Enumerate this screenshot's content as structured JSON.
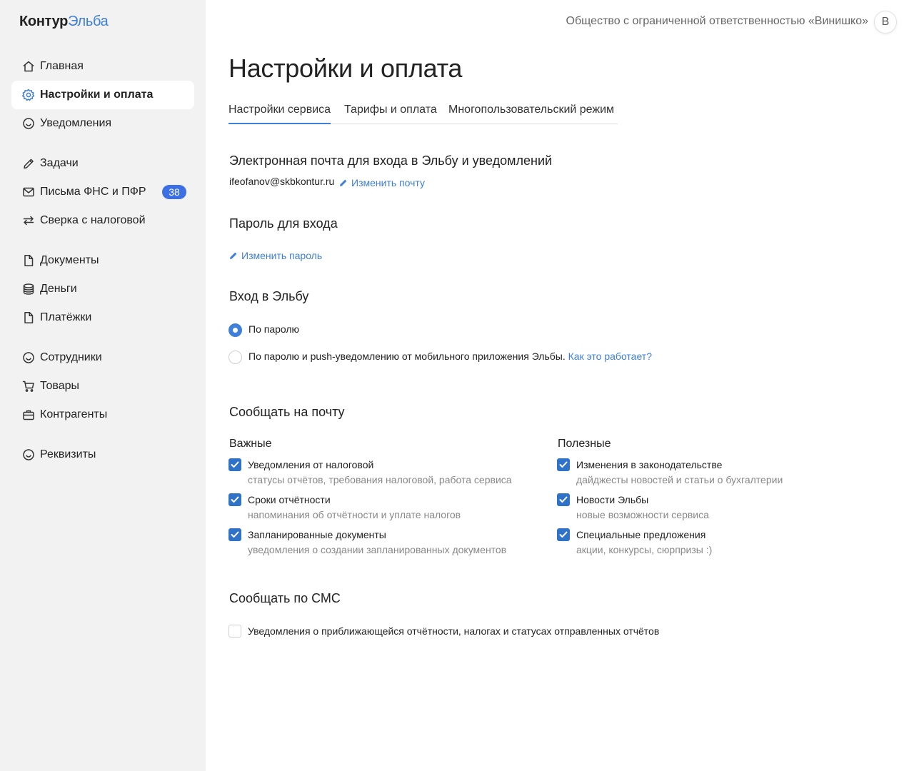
{
  "brand": {
    "name": "Контур",
    "product": "Эльба"
  },
  "sidebar": {
    "items": [
      {
        "label": "Главная",
        "icon": "home-icon"
      },
      {
        "label": "Настройки и оплата",
        "icon": "settings-gear-icon",
        "active": true
      },
      {
        "label": "Уведомления",
        "icon": "smiley-icon"
      },
      {
        "label": "Задачи",
        "icon": "pencil-icon"
      },
      {
        "label": "Письма ФНС и ПФР",
        "icon": "envelope-icon",
        "badge": "38"
      },
      {
        "label": "Сверка с налоговой",
        "icon": "swap-arrows-icon"
      },
      {
        "label": "Документы",
        "icon": "document-icon"
      },
      {
        "label": "Деньги",
        "icon": "coins-stack-icon"
      },
      {
        "label": "Платёжки",
        "icon": "document-icon"
      },
      {
        "label": "Сотрудники",
        "icon": "smiley-icon"
      },
      {
        "label": "Товары",
        "icon": "cart-icon"
      },
      {
        "label": "Контрагенты",
        "icon": "briefcase-icon"
      },
      {
        "label": "Реквизиты",
        "icon": "smiley-icon"
      }
    ]
  },
  "header": {
    "org_name": "Общество с ограниченной ответственностью «Винишко»",
    "avatar_letter": "В"
  },
  "main": {
    "title": "Настройки и оплата",
    "tabs": [
      {
        "label": "Настройки сервиса",
        "active": true
      },
      {
        "label": "Тарифы и оплата"
      },
      {
        "label": "Многопользовательский режим"
      }
    ],
    "email_section": {
      "title": "Электронная почта для входа в Эльбу и уведомлений",
      "email": "ifeofanov@skbkontur.ru",
      "change_link": "Изменить почту"
    },
    "password_section": {
      "title": "Пароль для входа",
      "change_link": "Изменить пароль"
    },
    "login_section": {
      "title": "Вход в Эльбу",
      "options": [
        {
          "label": "По паролю",
          "selected": true
        },
        {
          "label": "По паролю и push-уведомлению от мобильного приложения Эльбы.",
          "selected": false,
          "link": "Как это работает?"
        }
      ]
    },
    "email_notify": {
      "title": "Сообщать на почту",
      "important": {
        "title": "Важные",
        "items": [
          {
            "label": "Уведомления от налоговой",
            "desc": "статусы отчётов, требования налоговой, работа сервиса",
            "checked": true
          },
          {
            "label": "Сроки отчётности",
            "desc": "напоминания об отчётности и уплате налогов",
            "checked": true
          },
          {
            "label": "Запланированные документы",
            "desc": "уведомления о создании запланированных документов",
            "checked": true
          }
        ]
      },
      "useful": {
        "title": "Полезные",
        "items": [
          {
            "label": "Изменения в законодательстве",
            "desc": "дайджесты новостей и статьи о бухгалтерии",
            "checked": true
          },
          {
            "label": "Новости Эльбы",
            "desc": "новые возможности сервиса",
            "checked": true
          },
          {
            "label": "Специальные предложения",
            "desc": "акции, конкурсы, сюрпризы :)",
            "checked": true
          }
        ]
      }
    },
    "sms_notify": {
      "title": "Сообщать по СМС",
      "item": {
        "label": "Уведомления о приближающейся отчётности, налогах и статусах отправленных отчётов",
        "checked": false
      }
    }
  },
  "colors": {
    "accent": "#3d7fd9",
    "checkbox": "#2f73c8",
    "badge": "#3b6fe3",
    "sidebar_bg": "#f2f2f2"
  }
}
